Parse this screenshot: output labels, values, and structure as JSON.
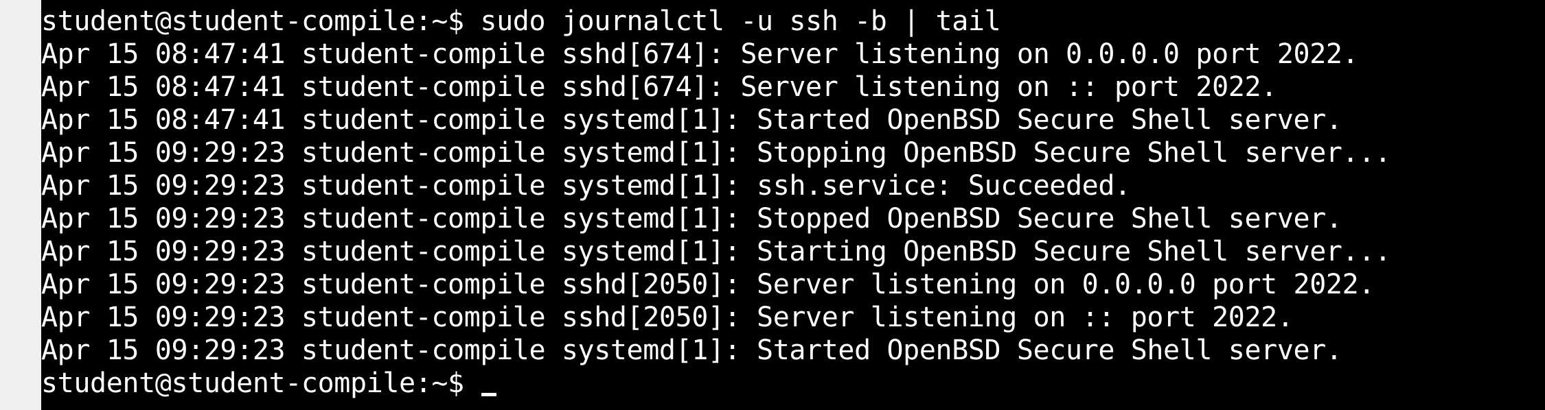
{
  "terminal": {
    "command_line": {
      "prompt": "student@student-compile:~$ ",
      "command": "sudo journalctl -u ssh -b | tail"
    },
    "output_lines": [
      "Apr 15 08:47:41 student-compile sshd[674]: Server listening on 0.0.0.0 port 2022.",
      "Apr 15 08:47:41 student-compile sshd[674]: Server listening on :: port 2022.",
      "Apr 15 08:47:41 student-compile systemd[1]: Started OpenBSD Secure Shell server.",
      "Apr 15 09:29:23 student-compile systemd[1]: Stopping OpenBSD Secure Shell server...",
      "Apr 15 09:29:23 student-compile systemd[1]: ssh.service: Succeeded.",
      "Apr 15 09:29:23 student-compile systemd[1]: Stopped OpenBSD Secure Shell server.",
      "Apr 15 09:29:23 student-compile systemd[1]: Starting OpenBSD Secure Shell server...",
      "Apr 15 09:29:23 student-compile sshd[2050]: Server listening on 0.0.0.0 port 2022.",
      "Apr 15 09:29:23 student-compile sshd[2050]: Server listening on :: port 2022.",
      "Apr 15 09:29:23 student-compile systemd[1]: Started OpenBSD Secure Shell server."
    ],
    "current_prompt": "student@student-compile:~$ ",
    "colors": {
      "background": "#000000",
      "foreground": "#ffffff",
      "margin": "#f0f0f0"
    }
  }
}
